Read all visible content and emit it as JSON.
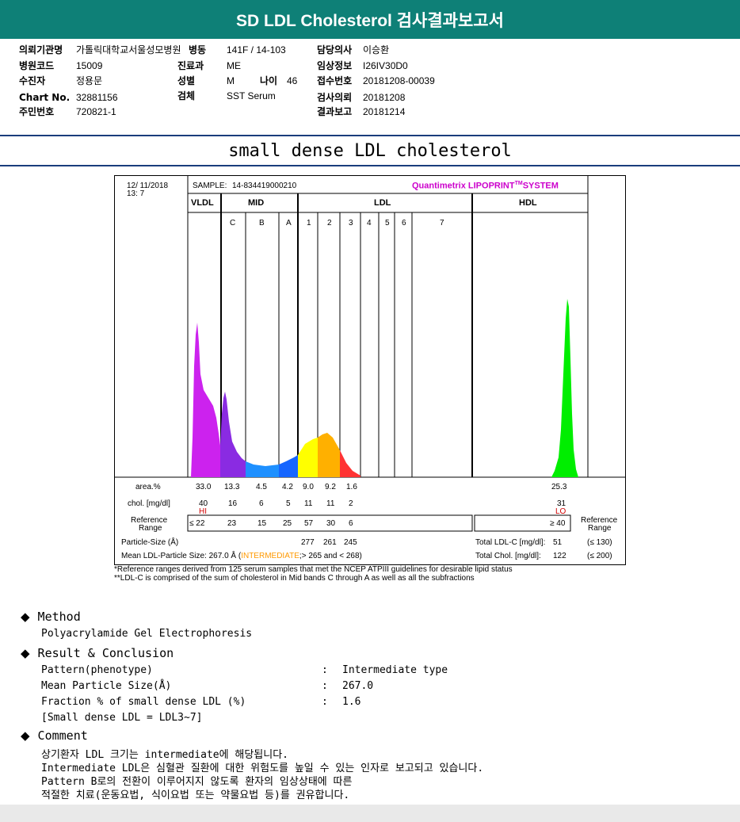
{
  "header": {
    "title": "SD LDL Cholesterol 검사결과보고서"
  },
  "info": {
    "col1": [
      {
        "label": "의뢰기관명",
        "value": "가톨릭대학교서울성모병원"
      },
      {
        "label": "병원코드",
        "value": "15009"
      },
      {
        "label": "수진자",
        "value": "정용문"
      },
      {
        "label": "Chart No.",
        "value": "32881156"
      },
      {
        "label": "주민번호",
        "value": "720821-1"
      }
    ],
    "col2": [
      {
        "label": "병동",
        "value": "141F / 14-103"
      },
      {
        "label": "진료과",
        "value": "ME"
      },
      {
        "label": "성별",
        "value": "M"
      },
      {
        "label": "검체",
        "value": "SST Serum"
      }
    ],
    "age": {
      "label": "나이",
      "value": "46"
    },
    "col3": [
      {
        "label": "담당의사",
        "value": "이승환"
      },
      {
        "label": "임상정보",
        "value": "I26IV30D0"
      },
      {
        "label": "접수번호",
        "value": "20181208-00039"
      },
      {
        "label": "검사의뢰",
        "value": "20181208"
      },
      {
        "label": "결과보고",
        "value": "20181214"
      }
    ]
  },
  "subtitle": "small dense LDL cholesterol",
  "report": {
    "date": "12/ 11/2018",
    "time": "13: 7",
    "sample_label": "SAMPLE:",
    "sample_id": "14-834419000210",
    "brand": "Quantimetrix LIPOPRINT",
    "brand_tm": "TM",
    "brand_suffix": "SYSTEM",
    "groups": [
      "VLDL",
      "MID",
      "LDL",
      "HDL"
    ],
    "bands": [
      "C",
      "B",
      "A",
      "1",
      "2",
      "3",
      "4",
      "5",
      "6",
      "7"
    ],
    "area_label": "area.%",
    "chol_label": "chol. [mg/dl]",
    "ref_label_1": "Reference",
    "ref_label_2": "Range",
    "area": [
      "33.0",
      "13.3",
      "4.5",
      "4.2",
      "9.0",
      "9.2",
      "1.6",
      "25.3"
    ],
    "chol": [
      "40",
      "16",
      "6",
      "5",
      "11",
      "11",
      "2",
      "31"
    ],
    "flags": {
      "vldl": "HI",
      "hdl": "LO"
    },
    "ref": [
      "≤ 22",
      "23",
      "15",
      "25",
      "57",
      "30",
      "6",
      "≥ 40"
    ],
    "particle_size_label": "Particle-Size (Å)",
    "particle_sizes": [
      "277",
      "261",
      "245"
    ],
    "mean_label": "Mean LDL-Particle Size:",
    "mean_value": "267.0 Å (",
    "mean_class": "INTERMEDIATE",
    "mean_suffix": ";> 265 and < 268)",
    "total_ldl_label": "Total LDL-C [mg/dl]:",
    "total_ldl_value": "51",
    "total_ldl_ref": "(≤ 130)",
    "total_chol_label": "Total Chol. [mg/dl]:",
    "total_chol_value": "122",
    "total_chol_ref": "(≤ 200)",
    "right_ref_1": "Reference",
    "right_ref_2": "Range"
  },
  "footnotes": [
    "*Reference ranges derived from 125 serum samples that met the NCEP ATPIII guidelines for desirable lipid status",
    "**LDL-C is comprised of the sum of cholesterol in Mid bands C through A as well as all the subfractions"
  ],
  "method": {
    "heading": "Method",
    "text": "Polyacrylamide Gel Electrophoresis"
  },
  "result": {
    "heading": "Result & Conclusion",
    "rows": [
      {
        "label": "Pattern(phenotype)",
        "sep": ":",
        "value": "Intermediate type"
      },
      {
        "label": "Mean Particle Size(Å)",
        "sep": ":",
        "value": "267.0"
      },
      {
        "label": "Fraction % of small dense LDL (%)",
        "sep": ":",
        "value": "1.6"
      }
    ],
    "note": "[Small dense LDL = LDL3~7]"
  },
  "comment": {
    "heading": "Comment",
    "lines": [
      "상기환자 LDL 크기는 intermediate에 해당됩니다.",
      "Intermediate LDL은 심혈관 질환에 대한 위험도를 높일 수 있는 인자로 보고되고 있습니다.",
      "Pattern B로의 전환이 이루어지지 않도록 환자의 임상상태에 따른",
      "적절한 치료(운동요법, 식이요법 또는 약물요법 등)를 권유합니다."
    ]
  },
  "colors": {
    "header_bg": "#0e8077",
    "vldl": "#cc22ee",
    "mid_c": "#8a2be2",
    "mid_b": "#1e90ff",
    "mid_a": "#1565ff",
    "ldl1": "#ffff00",
    "ldl2": "#ffb000",
    "ldl3": "#ff3333",
    "hdl": "#00ee00",
    "intermediate": "#ff9900",
    "flag": "#d00000",
    "brand": "#cc00cc"
  }
}
